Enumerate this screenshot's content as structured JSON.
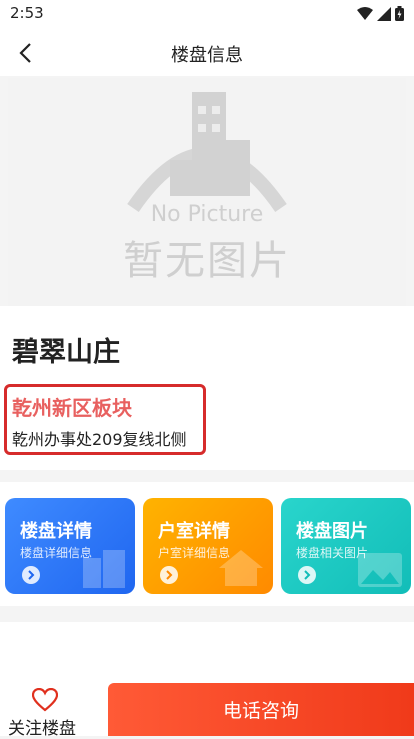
{
  "status_bar": {
    "time": "2:53"
  },
  "nav": {
    "title": "楼盘信息"
  },
  "photo": {
    "placeholder_en": "No Picture",
    "placeholder_cn": "暂无图片"
  },
  "project": {
    "name": "碧翠山庄",
    "district": "乾州新区板块",
    "address": "乾州办事处209复线北侧"
  },
  "cards": [
    {
      "title": "楼盘详情",
      "subtitle": "楼盘详细信息"
    },
    {
      "title": "户室详情",
      "subtitle": "户室详细信息"
    },
    {
      "title": "楼盘图片",
      "subtitle": "楼盘相关图片"
    }
  ],
  "bottom": {
    "favorite_label": "关注楼盘",
    "call_label": "电话咨询"
  },
  "colors": {
    "accent": "#f03a1a",
    "highlight": "#d62b2b",
    "district": "#e8605f"
  }
}
